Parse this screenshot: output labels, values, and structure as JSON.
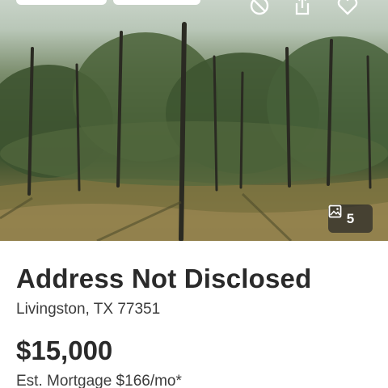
{
  "hero": {
    "badges": [
      "",
      ""
    ],
    "icons": {
      "hide": "hide-icon",
      "share": "share-icon",
      "save": "heart-icon",
      "gallery": "image-icon"
    },
    "photo_count": "5"
  },
  "listing": {
    "title": "Address Not Disclosed",
    "location": "Livingston, TX 77351",
    "price": "$15,000",
    "mortgage": "Est. Mortgage $166/mo*"
  },
  "colors": {
    "text_primary": "#2a2a2a",
    "text_secondary": "#3c3c3c",
    "overlay_badge": "#282828"
  }
}
